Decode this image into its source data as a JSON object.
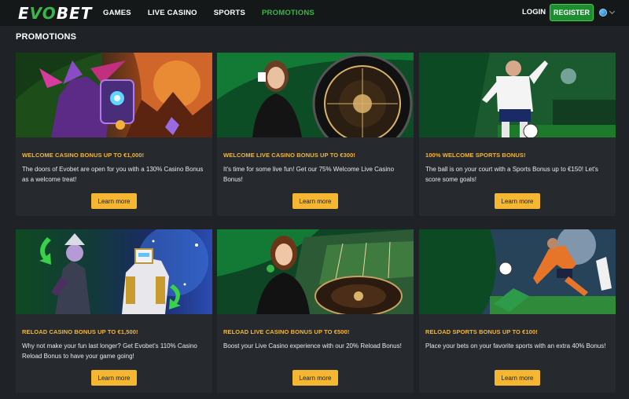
{
  "header": {
    "logo": {
      "part1": "E",
      "part2": "VO",
      "part3": "BET"
    },
    "nav": [
      "GAMES",
      "LIVE CASINO",
      "SPORTS",
      "PROMOTIONS"
    ],
    "active_nav": "PROMOTIONS",
    "login_label": "LOGIN",
    "register_label": "REGISTER",
    "language_icon": "globe-icon",
    "accent_color": "#39b54a"
  },
  "page": {
    "title": "PROMOTIONS"
  },
  "promotions": [
    {
      "title": "WELCOME CASINO BONUS UP TO €1,000!",
      "description": "The doors of Evobet are open for you with a 130% Casino Bonus as a welcome treat!",
      "button": "Learn more",
      "image": "fantasy-knight-casino-art"
    },
    {
      "title": "WELCOME LIVE CASINO BONUS UP TO €300!",
      "description": "It's time for some live fun! Get our 75% Welcome Live Casino Bonus!",
      "button": "Learn more",
      "image": "live-dealer-roulette-wheel"
    },
    {
      "title": "100% WELCOME SPORTS BONUS!",
      "description": "The ball is on your court with a Sports Bonus up to €150! Let's score some goals!",
      "button": "Learn more",
      "image": "football-player-celebrating"
    },
    {
      "title": "RELOAD CASINO BONUS UP TO €1,500!",
      "description": "Why not make your fun last longer? Get Evobet's 110% Casino Reload Bonus to have your game going!",
      "button": "Learn more",
      "image": "robot-and-elf-characters"
    },
    {
      "title": "RELOAD LIVE CASINO BONUS UP TO €500!",
      "description": "Boost your Live Casino experience with our 20% Reload Bonus!",
      "button": "Learn more",
      "image": "dealer-at-roulette-table"
    },
    {
      "title": "RELOAD SPORTS BONUS UP TO €100!",
      "description": "Place your bets on your favorite sports with an extra 40% Bonus!",
      "button": "Learn more",
      "image": "football-match-action"
    }
  ],
  "colors": {
    "promo_title": "#f5b632",
    "button_bg": "#f5b632",
    "card_bg": "#262a2e",
    "page_bg": "#1f2327"
  }
}
